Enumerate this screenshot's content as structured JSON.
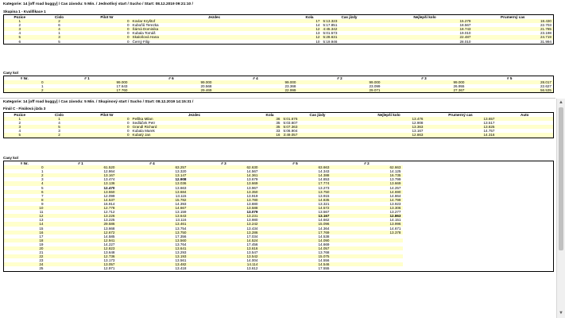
{
  "top": {
    "meta": "Kategorie: 14 [off road buggy] / Cas závodu: 5 Min. / Jednotlivý start / Sucho / Start: 08.12.2019 09:21:10 /",
    "group": "Skupina 1 - Kvalifikace 1",
    "results_headers": [
      "Pozice",
      "Cislo",
      "Pilot Nr",
      "Jezdec",
      "Kola",
      "Cas jízdy",
      "Nejlepší kolo",
      "Prumerný cas"
    ],
    "results": [
      [
        "1",
        "2",
        "0",
        "Kovlar Kryštof",
        "17",
        "5:13.323",
        "15.279",
        "18.430"
      ],
      [
        "2",
        "6",
        "0",
        "Kuboňů Terezka",
        "14",
        "5:17.851",
        "18.567",
        "22.703"
      ],
      [
        "3",
        "4",
        "0",
        "Šárná Dominika",
        "12",
        "4:45.342",
        "18.743",
        "21.785"
      ],
      [
        "4",
        "1",
        "0",
        "Kubala Tomáš",
        "13",
        "5:01.573",
        "19.010",
        "23.198"
      ],
      [
        "5",
        "3",
        "0",
        "Skalošová Hana",
        "12",
        "5:28.631",
        "22.487",
        "24.719"
      ],
      [
        "6",
        "5",
        "0",
        "Černý Filip",
        "10",
        "5:19.946",
        "28.010",
        "31.994"
      ]
    ],
    "laps_title": "Casy kol",
    "laps_headers": [
      "# Nr.",
      "# 1",
      "# 6",
      "# 4",
      "# 2",
      "# 3",
      "# 5"
    ],
    "laps": [
      [
        "0",
        "99.000",
        "99.000",
        "99.000",
        "99.000",
        "99.000",
        "28.017"
      ],
      [
        "1",
        "17.643",
        "20.568",
        "23.368",
        "23.099",
        "26.955",
        "22.627"
      ],
      [
        "2",
        "17.760",
        "29.469",
        "22.999",
        "29.071",
        "27.367",
        "56.535"
      ]
    ]
  },
  "bottom": {
    "meta": "Kategorie: 14 [off road buggy] / Cas závodu: 5 Min. / Skupinový start / Sucho / Start: 08.12.2019 14:15:31 /",
    "group": "Finál C - Finálová jízda 3",
    "results_headers": [
      "Pozice",
      "Cislo",
      "Pilot Nr",
      "Jezdec",
      "Kola",
      "Cas jízdy",
      "Nejlepší kolo",
      "Prumerný cas",
      "Auto"
    ],
    "results": [
      [
        "1",
        "1",
        "0",
        "Pešlka Milan",
        "36",
        "5:01.676",
        "13.476",
        "13.657",
        ""
      ],
      [
        "2",
        "4",
        "0",
        "Sedláček Petr",
        "35",
        "5:03.607",
        "12.908",
        "13.517",
        ""
      ],
      [
        "3",
        "5",
        "0",
        "Grandl Richard",
        "35",
        "5:07.363",
        "13.363",
        "13.825",
        ""
      ],
      [
        "4",
        "3",
        "0",
        "Kubala Marek",
        "33",
        "5:06.904",
        "13.167",
        "14.757",
        ""
      ],
      [
        "5",
        "2",
        "0",
        "Kubatý Jan",
        "16",
        "3:49.057",
        "12.863",
        "14.316",
        ""
      ]
    ],
    "laps_title": "Casy kol",
    "laps_headers": [
      "# Nr.",
      "# 1",
      "# 4",
      "# 3",
      "# 5",
      "# 2"
    ],
    "laps": [
      [
        "0",
        "61.520",
        "63.257",
        "62.630",
        "63.663",
        "62.663"
      ],
      [
        "1",
        "12.864",
        "13.320",
        "14.567",
        "14.343",
        "14.125"
      ],
      [
        "2",
        "13.167",
        "13.147",
        "14.361",
        "14.388",
        "16.735"
      ],
      [
        "3",
        "13.474",
        "12.908",
        "13.679",
        "14.853",
        "13.799"
      ],
      [
        "4",
        "13.136",
        "13.036",
        "13.669",
        "17.774",
        "13.669"
      ],
      [
        "5",
        "12.470",
        "13.663",
        "13.967",
        "13.273",
        "14.257"
      ],
      [
        "6",
        "13.550",
        "13.684",
        "13.350",
        "13.750",
        "14.690"
      ],
      [
        "7",
        "12.099",
        "13.115",
        "13.919",
        "13.915",
        "14.864"
      ],
      [
        "8",
        "14.537",
        "15.782",
        "13.780",
        "14.835",
        "14.799"
      ],
      [
        "9",
        "16.914",
        "14.393",
        "13.880",
        "13.321",
        "13.923"
      ],
      [
        "10",
        "12.778",
        "14.667",
        "13.588",
        "14.572",
        "13.306"
      ],
      [
        "11",
        "12.712",
        "13.159",
        "13.079",
        "13.567",
        "13.277"
      ],
      [
        "12",
        "13.226",
        "13.643",
        "13.231",
        "13.167",
        "12.863"
      ],
      [
        "13",
        "13.225",
        "13.116",
        "13.980",
        "14.662",
        "14.151"
      ],
      [
        "14",
        "29.586",
        "13.461",
        "13.242",
        "15.096",
        "13.996"
      ],
      [
        "15",
        "13.668",
        "13.754",
        "13.434",
        "14.364",
        "14.671"
      ],
      [
        "16",
        "12.672",
        "13.750",
        "13.286",
        "17.769",
        "13.378"
      ],
      [
        "17",
        "14.585",
        "17.356",
        "17.034",
        "14.538",
        ""
      ],
      [
        "18",
        "12.941",
        "13.560",
        "14.524",
        "14.090",
        ""
      ],
      [
        "19",
        "14.227",
        "13.764",
        "17.456",
        "14.669",
        ""
      ],
      [
        "20",
        "12.823",
        "13.641",
        "13.616",
        "14.057",
        ""
      ],
      [
        "21",
        "13.648",
        "13.293",
        "13.547",
        "13.768",
        ""
      ],
      [
        "22",
        "12.736",
        "13.193",
        "13.542",
        "15.075",
        ""
      ],
      [
        "23",
        "13.173",
        "13.561",
        "14.004",
        "14.556",
        ""
      ],
      [
        "24",
        "13.057",
        "13.482",
        "14.114",
        "14.546",
        ""
      ],
      [
        "25",
        "12.971",
        "13.418",
        "13.612",
        "17.555",
        ""
      ]
    ]
  },
  "colors": {
    "row_alt": "#ffffcc",
    "border": "#000000",
    "scrollbar": "#f0f0f0",
    "thumb": "#c1c1c1"
  },
  "icons": {
    "scroll_up": "chevron-up-icon",
    "scroll_down": "chevron-down-icon"
  },
  "scroll": {
    "up": "▲",
    "down": "▼"
  }
}
